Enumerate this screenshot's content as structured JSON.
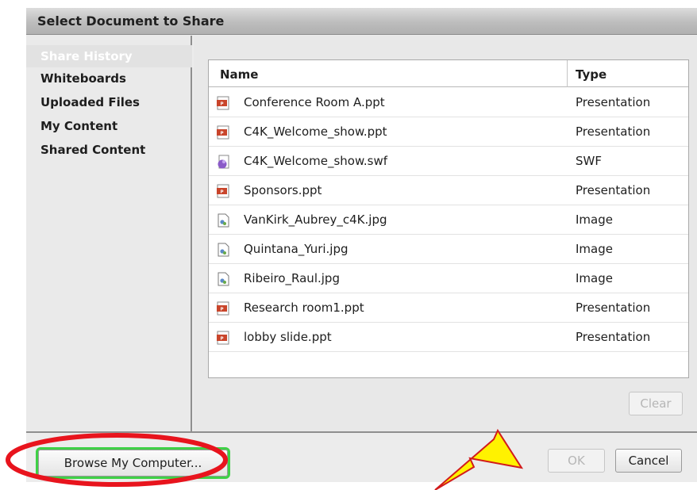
{
  "dialog": {
    "title": "Select Document to Share"
  },
  "sidebar": {
    "items": [
      {
        "label": "Share History",
        "selected": true
      },
      {
        "label": "Whiteboards",
        "selected": false
      },
      {
        "label": "Uploaded Files",
        "selected": false
      },
      {
        "label": "My Content",
        "selected": false
      },
      {
        "label": "Shared Content",
        "selected": false
      }
    ]
  },
  "table": {
    "columns": [
      "Name",
      "Type"
    ],
    "rows": [
      {
        "name": "Conference Room A.ppt",
        "type": "Presentation",
        "icon": "ppt-file-icon"
      },
      {
        "name": "C4K_Welcome_show.ppt",
        "type": "Presentation",
        "icon": "ppt-file-icon"
      },
      {
        "name": "C4K_Welcome_show.swf",
        "type": "SWF",
        "icon": "swf-file-icon"
      },
      {
        "name": "Sponsors.ppt",
        "type": "Presentation",
        "icon": "ppt-file-icon"
      },
      {
        "name": "VanKirk_Aubrey_c4K.jpg",
        "type": "Image",
        "icon": "image-file-icon"
      },
      {
        "name": "Quintana_Yuri.jpg",
        "type": "Image",
        "icon": "image-file-icon"
      },
      {
        "name": "Ribeiro_Raul.jpg",
        "type": "Image",
        "icon": "image-file-icon"
      },
      {
        "name": "Research room1.ppt",
        "type": "Presentation",
        "icon": "ppt-file-icon"
      },
      {
        "name": "lobby slide.ppt",
        "type": "Presentation",
        "icon": "ppt-file-icon"
      }
    ]
  },
  "buttons": {
    "clear": "Clear",
    "browse": "Browse My Computer...",
    "ok": "OK",
    "cancel": "Cancel"
  },
  "button_states": {
    "clear_enabled": false,
    "ok_enabled": false,
    "cancel_enabled": true,
    "browse_enabled": true
  },
  "colors": {
    "highlight_ellipse": "#e8141d",
    "highlight_box": "#3fd046",
    "arrow_fill": "#fff200",
    "arrow_stroke": "#d21b1b"
  }
}
